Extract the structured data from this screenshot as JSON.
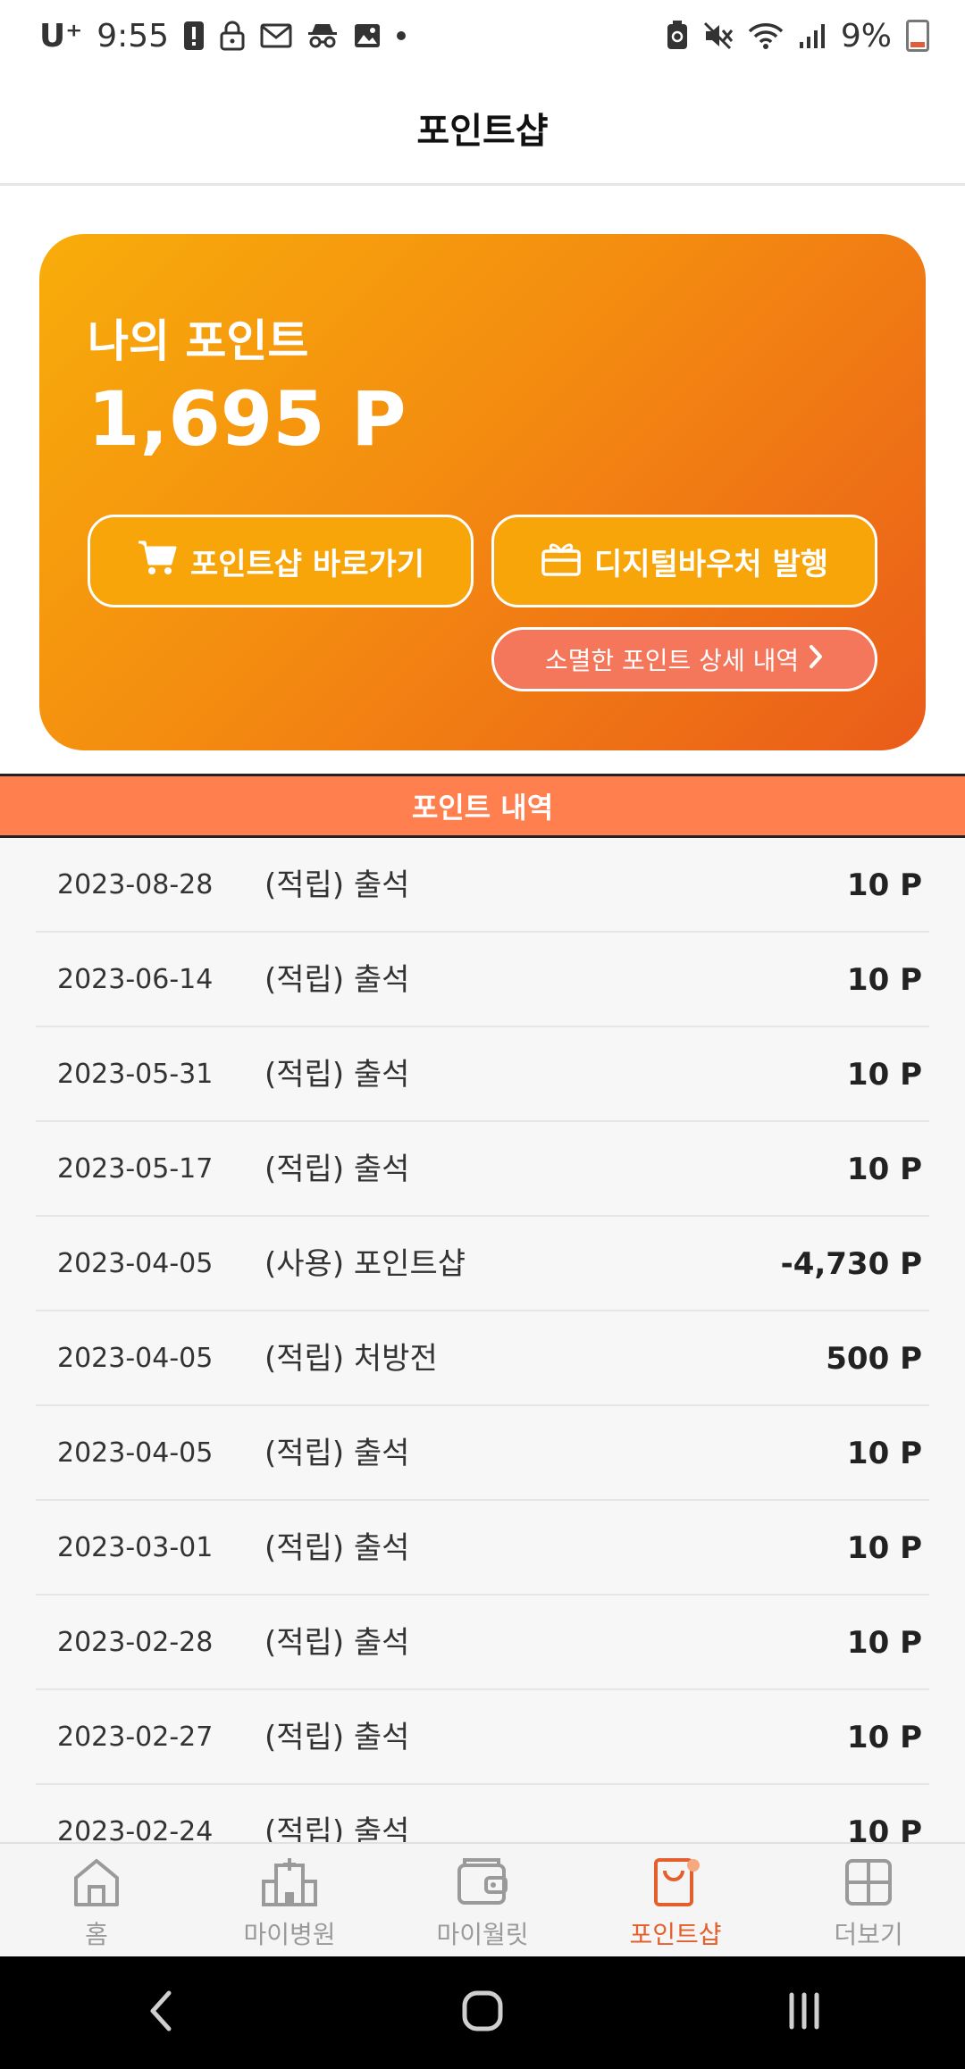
{
  "status_bar": {
    "carrier": "U⁺",
    "time": "9:55",
    "battery": "9%"
  },
  "header": {
    "title": "포인트샵"
  },
  "points_card": {
    "label": "나의 포인트",
    "points": "1,695 P",
    "shop_button": "포인트샵 바로가기",
    "voucher_button": "디지털바우처 발행",
    "expired_button": "소멸한 포인트 상세 내역"
  },
  "history": {
    "title": "포인트 내역",
    "rows": [
      {
        "date": "2023-08-28",
        "desc": "(적립) 출석",
        "amount": "10 P"
      },
      {
        "date": "2023-06-14",
        "desc": "(적립) 출석",
        "amount": "10 P"
      },
      {
        "date": "2023-05-31",
        "desc": "(적립) 출석",
        "amount": "10 P"
      },
      {
        "date": "2023-05-17",
        "desc": "(적립) 출석",
        "amount": "10 P"
      },
      {
        "date": "2023-04-05",
        "desc": "(사용) 포인트샵",
        "amount": "-4,730 P"
      },
      {
        "date": "2023-04-05",
        "desc": "(적립) 처방전",
        "amount": "500 P"
      },
      {
        "date": "2023-04-05",
        "desc": "(적립) 출석",
        "amount": "10 P"
      },
      {
        "date": "2023-03-01",
        "desc": "(적립) 출석",
        "amount": "10 P"
      },
      {
        "date": "2023-02-28",
        "desc": "(적립) 출석",
        "amount": "10 P"
      },
      {
        "date": "2023-02-27",
        "desc": "(적립) 출석",
        "amount": "10 P"
      },
      {
        "date": "2023-02-24",
        "desc": "(적립) 출석",
        "amount": "10 P"
      }
    ]
  },
  "bottom_nav": {
    "items": [
      {
        "label": "홈",
        "icon": "home-icon"
      },
      {
        "label": "마이병원",
        "icon": "hospital-icon"
      },
      {
        "label": "마이월릿",
        "icon": "wallet-icon"
      },
      {
        "label": "포인트샵",
        "icon": "shopping-bag-icon"
      },
      {
        "label": "더보기",
        "icon": "grid-icon"
      }
    ],
    "active_index": 3
  },
  "colors": {
    "accent": "#e55f2c",
    "history_header": "#ff7f4f",
    "card_start": "#f8ad0a",
    "card_end": "#ea5c1a"
  }
}
